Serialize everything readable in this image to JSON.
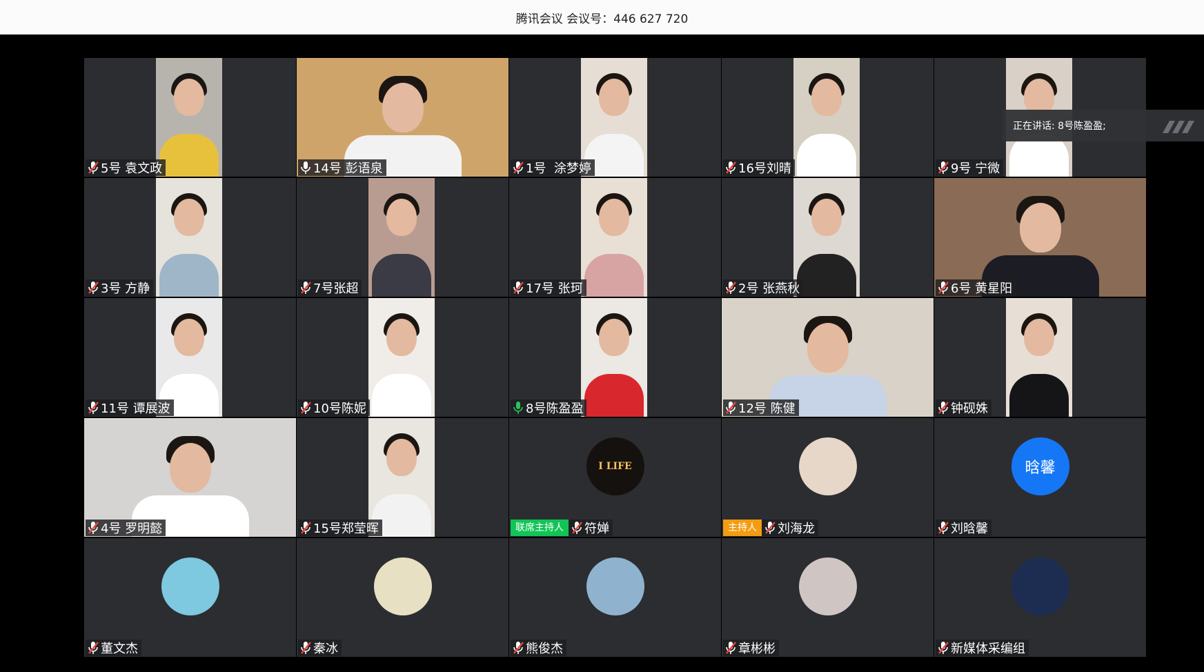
{
  "title": "腾讯会议 会议号：446 627 720",
  "speaking": "正在讲话: 8号陈盈盈;",
  "tag_cohost": "联席主持人",
  "tag_host": "主持人",
  "tiles": [
    {
      "name": "5号 袁文政",
      "mic": "muted",
      "shirt": "#e8c13c",
      "bg": "#b7b4ae"
    },
    {
      "name": "14号 彭语泉",
      "mic": "on-white",
      "full": true,
      "shirt": "#f2f2f2",
      "bg": "#cfa46b"
    },
    {
      "name": "1号  涂梦婷",
      "mic": "muted",
      "shirt": "#f4f4f4",
      "bg": "#e6ded5"
    },
    {
      "name": "16号刘晴",
      "mic": "muted",
      "shirt": "#ffffff",
      "bg": "#d6cfc3"
    },
    {
      "name": "9号 宁微",
      "mic": "muted",
      "shirt": "#ffffff",
      "bg": "#d9d0c8"
    },
    {
      "name": "3号 方静",
      "mic": "muted",
      "shirt": "#9fb6c8",
      "bg": "#e6e2dc"
    },
    {
      "name": "7号张超",
      "mic": "muted",
      "shirt": "#3b3b45",
      "bg": "#b99c91"
    },
    {
      "name": "17号 张珂",
      "mic": "muted",
      "shirt": "#d7a3a3",
      "bg": "#e8dfd5"
    },
    {
      "name": "2号 张燕秋",
      "mic": "muted",
      "shirt": "#222222",
      "bg": "#ddd8d2"
    },
    {
      "name": "6号 黄星阳",
      "mic": "muted",
      "full": true,
      "shirt": "#1c1c24",
      "bg": "#8a6b55"
    },
    {
      "name": "11号 谭展波",
      "mic": "muted",
      "shirt": "#ffffff",
      "bg": "#e9e9e9"
    },
    {
      "name": "10号陈妮",
      "mic": "muted",
      "shirt": "#ffffff",
      "bg": "#f0ede9"
    },
    {
      "name": "8号陈盈盈",
      "mic": "on-green",
      "shirt": "#d9272e",
      "bg": "#ece8e3"
    },
    {
      "name": "12号 陈健",
      "mic": "muted",
      "full": true,
      "shirt": "#c7d3e6",
      "bg": "#d9d2c8"
    },
    {
      "name": "钟砚姝",
      "mic": "muted",
      "shirt": "#151518",
      "bg": "#e7dfd6"
    },
    {
      "name": "4号 罗明懿",
      "mic": "muted",
      "full": true,
      "shirt": "#ffffff",
      "bg": "#d6d4d2"
    },
    {
      "name": "15号郑莹晖",
      "mic": "muted",
      "shirt": "#f2f2f2",
      "bg": "#e9e5df"
    },
    {
      "name": "符婵",
      "mic": "muted",
      "avatar": "pic",
      "avatar_bg": "#15110f",
      "avatar_text": "I LIFE",
      "tag": "cohost"
    },
    {
      "name": "刘海龙",
      "mic": "muted",
      "avatar": "pic",
      "avatar_bg": "#e7d7c8",
      "avatar_text": "",
      "tag": "host"
    },
    {
      "name": "刘晗馨",
      "mic": "muted",
      "avatar": "text",
      "avatar_text": "晗馨"
    },
    {
      "name": "董文杰",
      "mic": "muted",
      "avatar": "pic",
      "avatar_bg": "#7ec8e0",
      "avatar_text": ""
    },
    {
      "name": "秦冰",
      "mic": "muted",
      "avatar": "pic",
      "avatar_bg": "#e8e0c3",
      "avatar_text": ""
    },
    {
      "name": "熊俊杰",
      "mic": "muted",
      "avatar": "pic",
      "avatar_bg": "#8fb3cf",
      "avatar_text": ""
    },
    {
      "name": "章彬彬",
      "mic": "muted",
      "avatar": "pic",
      "avatar_bg": "#cfc6c4",
      "avatar_text": ""
    },
    {
      "name": "新媒体采编组",
      "mic": "muted",
      "avatar": "pic",
      "avatar_bg": "#1d2d52",
      "avatar_text": ""
    }
  ]
}
